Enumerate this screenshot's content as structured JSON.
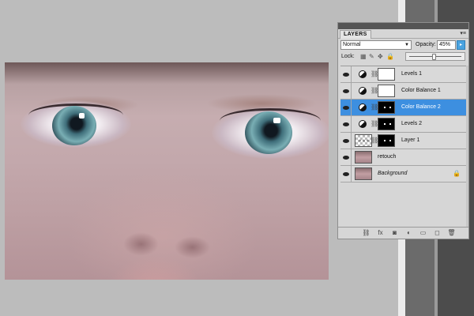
{
  "panel": {
    "tab_label": "LAYERS",
    "menu_icon": "panel-menu-icon",
    "blend_mode": "Normal",
    "opacity_label": "Opacity:",
    "opacity_value": "45%",
    "opacity_slider_fraction": 0.45,
    "lock_label": "Lock:",
    "layers": [
      {
        "name": "Levels 1",
        "type": "adjustment",
        "mask": "white",
        "selected": false
      },
      {
        "name": "Color Balance 1",
        "type": "adjustment",
        "mask": "white",
        "selected": false
      },
      {
        "name": "Color Balance 2",
        "type": "adjustment",
        "mask": "black",
        "selected": true
      },
      {
        "name": "Levels 2",
        "type": "adjustment",
        "mask": "black",
        "selected": false
      },
      {
        "name": "Layer 1",
        "type": "pixel-transparent",
        "mask": "black",
        "selected": false
      },
      {
        "name": "retouch",
        "type": "pixel",
        "mask": null,
        "selected": false
      },
      {
        "name": "Background",
        "type": "background",
        "mask": null,
        "selected": false,
        "locked": true
      }
    ],
    "footer_icons": [
      "link-icon",
      "fx-icon",
      "mask-icon",
      "adjustment-icon",
      "group-icon",
      "new-layer-icon",
      "trash-icon"
    ]
  },
  "colors": {
    "selection": "#3d8fe0",
    "panel_bg": "#d6d6d6",
    "workspace_bg": "#bcbcbc"
  }
}
